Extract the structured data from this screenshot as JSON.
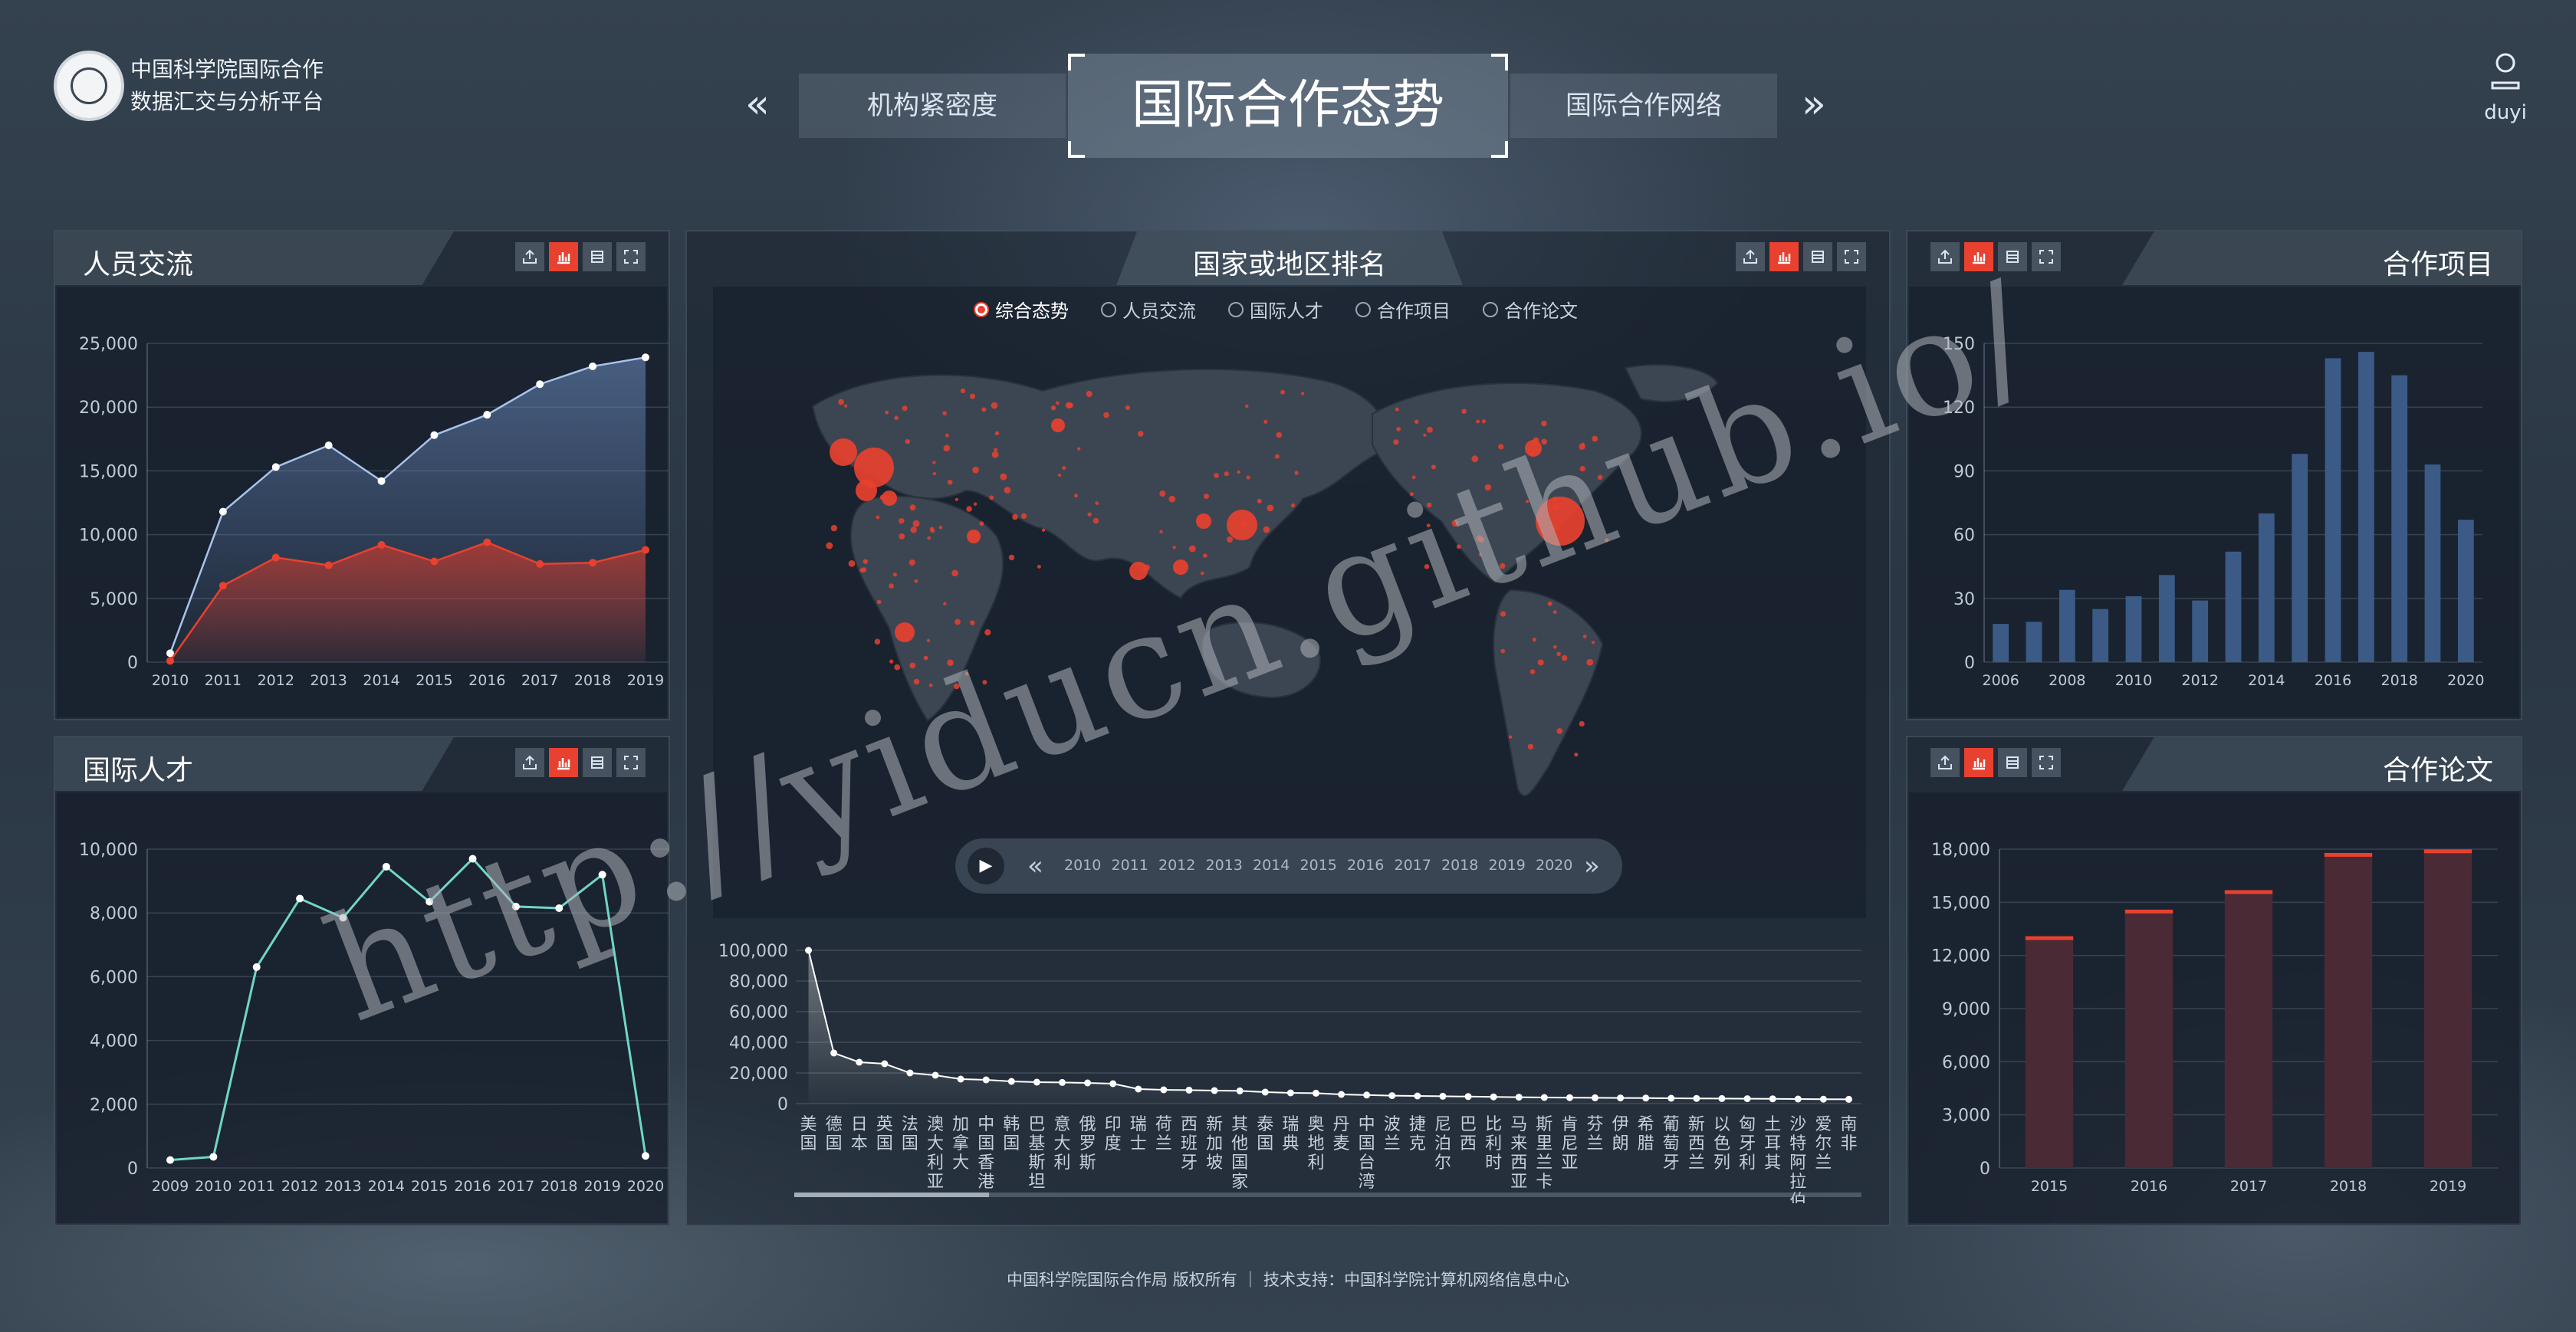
{
  "header": {
    "brand_line1": "中国科学院国际合作",
    "brand_line2": "数据汇交与分析平台",
    "nav_prev": "«",
    "nav_next": "»",
    "tab_left": "机构紧密度",
    "tab_main": "国际合作态势",
    "tab_right": "国际合作网络",
    "user": "duyi"
  },
  "panels": {
    "personnel": {
      "title": "人员交流"
    },
    "talent": {
      "title": "国际人才"
    },
    "ranking": {
      "title": "国家或地区排名"
    },
    "projects": {
      "title": "合作项目"
    },
    "papers": {
      "title": "合作论文"
    }
  },
  "radios": [
    "综合态势",
    "人员交流",
    "国际人才",
    "合作项目",
    "合作论文"
  ],
  "timeline": {
    "play": "▶",
    "prev": "«",
    "next": "»",
    "years": [
      "2010",
      "2011",
      "2012",
      "2013",
      "2014",
      "2015",
      "2016",
      "2017",
      "2018",
      "2019",
      "2020"
    ]
  },
  "footer": "中国科学院国际合作局 版权所有  ｜  技术支持：中国科学院计算机网络信息中心",
  "watermark": "http://yiducn.github.io/",
  "colors": {
    "accent": "#e8412f",
    "blue_line": "#a9c3ea",
    "teal_line": "#6fd6c8",
    "bar_blue": "#3b5a86",
    "bar_red": "#4a2a34"
  },
  "chart_data": [
    {
      "id": "personnel",
      "type": "area",
      "x": [
        "2010",
        "2011",
        "2012",
        "2013",
        "2014",
        "2015",
        "2016",
        "2017",
        "2018",
        "2019"
      ],
      "ylim": [
        0,
        25000
      ],
      "yticks": [
        "0",
        "5,000",
        "10,000",
        "15,000",
        "20,000",
        "25,000"
      ],
      "series": [
        {
          "values": [
            700,
            11800,
            15300,
            17000,
            14200,
            17800,
            19400,
            21800,
            23200,
            23900
          ]
        },
        {
          "values": [
            100,
            6000,
            8200,
            7600,
            9200,
            7900,
            9400,
            7700,
            7800,
            8800
          ]
        }
      ]
    },
    {
      "id": "talent",
      "type": "line",
      "x": [
        "2009",
        "2010",
        "2011",
        "2012",
        "2013",
        "2014",
        "2015",
        "2016",
        "2017",
        "2018",
        "2019",
        "2020"
      ],
      "ylim": [
        0,
        10000
      ],
      "yticks": [
        "0",
        "2,000",
        "4,000",
        "6,000",
        "8,000",
        "10,000"
      ],
      "series": [
        {
          "values": [
            250,
            350,
            6300,
            8450,
            7850,
            9450,
            8350,
            9700,
            8200,
            8150,
            9200,
            380
          ]
        }
      ]
    },
    {
      "id": "projects",
      "type": "bar",
      "x": [
        "2006",
        "2007",
        "2008",
        "2009",
        "2010",
        "2011",
        "2012",
        "2013",
        "2014",
        "2015",
        "2016",
        "2017",
        "2018",
        "2019",
        "2020"
      ],
      "xticks": [
        "2006",
        "2008",
        "2010",
        "2012",
        "2014",
        "2016",
        "2018",
        "2020"
      ],
      "ylim": [
        0,
        150
      ],
      "yticks": [
        "0",
        "30",
        "60",
        "90",
        "120",
        "150"
      ],
      "values": [
        18,
        19,
        34,
        25,
        31,
        41,
        29,
        52,
        70,
        98,
        143,
        146,
        135,
        93,
        67
      ]
    },
    {
      "id": "papers",
      "type": "bar",
      "x": [
        "2015",
        "2016",
        "2017",
        "2018",
        "2019"
      ],
      "ylim": [
        0,
        18000
      ],
      "yticks": [
        "0",
        "3,000",
        "6,000",
        "9,000",
        "12,000",
        "15,000",
        "18,000"
      ],
      "values": [
        13000,
        14500,
        15600,
        17700,
        17900
      ]
    },
    {
      "id": "ranking",
      "type": "line",
      "ylim": [
        0,
        100000
      ],
      "yticks": [
        "0",
        "20,000",
        "40,000",
        "60,000",
        "80,000",
        "100,000"
      ],
      "categories": [
        "美国",
        "德国",
        "日本",
        "英国",
        "法国",
        "澳大利亚",
        "加拿大",
        "中国香港",
        "韩国",
        "巴基斯坦",
        "意大利",
        "俄罗斯",
        "印度",
        "瑞士",
        "荷兰",
        "西班牙",
        "新加坡",
        "其他国家",
        "泰国",
        "瑞典",
        "奥地利",
        "丹麦",
        "中国台湾",
        "波兰",
        "捷克",
        "尼泊尔",
        "巴西",
        "比利时",
        "马来西亚",
        "斯里兰卡",
        "肯尼亚",
        "芬兰",
        "伊朗",
        "希腊",
        "葡萄牙",
        "新西兰",
        "以色列",
        "匈牙利",
        "土耳其",
        "沙特阿拉伯",
        "爱尔兰",
        "南非"
      ],
      "values": [
        111000,
        33000,
        27000,
        26000,
        20000,
        18500,
        16000,
        15500,
        14500,
        14000,
        13800,
        13500,
        13000,
        9500,
        9000,
        8800,
        8500,
        8300,
        7500,
        7000,
        6800,
        6000,
        5600,
        5200,
        5000,
        4800,
        4600,
        4400,
        4200,
        4000,
        3900,
        3800,
        3700,
        3600,
        3500,
        3400,
        3300,
        3200,
        3100,
        3000,
        2900,
        2800
      ]
    }
  ]
}
